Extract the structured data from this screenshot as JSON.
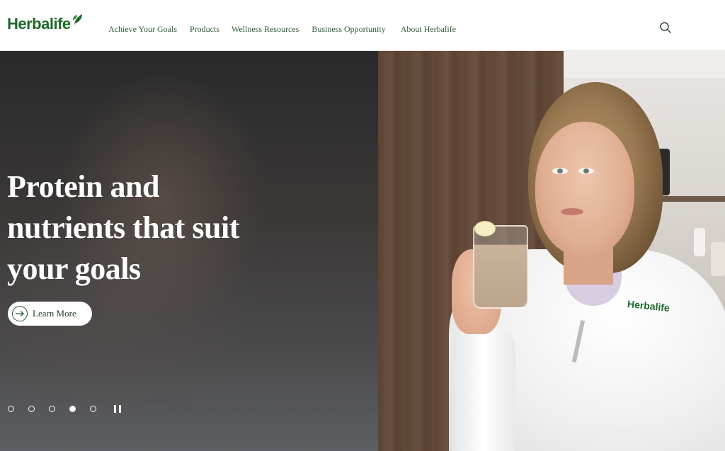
{
  "brand": {
    "name": "Herbalife",
    "color": "#1f6a2b"
  },
  "nav": {
    "items": [
      {
        "label": "Achieve Your Goals"
      },
      {
        "label": "Products"
      },
      {
        "label": "Wellness Resources"
      },
      {
        "label": "Business Opportunity"
      },
      {
        "label": "About Herbalife"
      }
    ],
    "search_icon": "search-icon"
  },
  "hero": {
    "title_lines": [
      "Protein and",
      "nutrients that suit",
      "your goals"
    ],
    "cta_label": "Learn More",
    "cta_icon": "arrow-right-circle-icon",
    "hoodie_logo_text": "Herbalife",
    "carousel": {
      "slide_count": 5,
      "active_index": 3,
      "control": "pause-icon"
    }
  }
}
